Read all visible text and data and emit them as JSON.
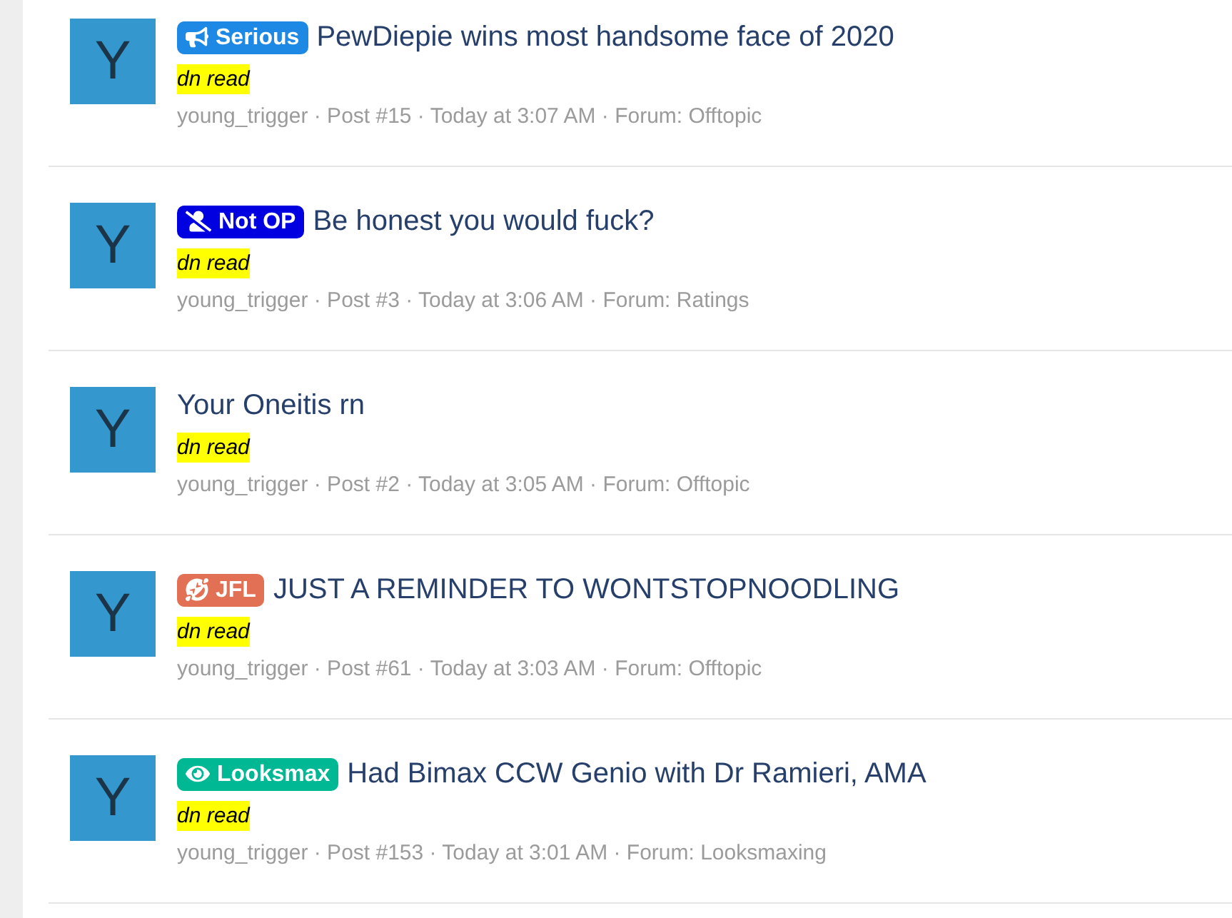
{
  "posts": [
    {
      "avatar": "Y",
      "prefix": {
        "kind": "megaphone",
        "label": "Serious",
        "color": "#1e88e5"
      },
      "title": "PewDiepie wins most handsome face of 2020",
      "note": "dn read",
      "meta": "young_trigger · Post #15 · Today at 3:07 AM · Forum: Offtopic"
    },
    {
      "avatar": "Y",
      "prefix": {
        "kind": "user-slash",
        "label": "Not OP",
        "color": "#0000e0"
      },
      "title": "Be honest you would fuck?",
      "note": "dn read",
      "meta": "young_trigger · Post #3 · Today at 3:06 AM · Forum: Ratings"
    },
    {
      "avatar": "Y",
      "title": "Your Oneitis rn",
      "note": "dn read",
      "meta": "young_trigger · Post #2 · Today at 3:05 AM · Forum: Offtopic"
    },
    {
      "avatar": "Y",
      "prefix": {
        "kind": "laugh",
        "label": "JFL",
        "color": "#e17055"
      },
      "title": "JUST A REMINDER TO WONTSTOPNOODLING",
      "note": "dn read",
      "meta": "young_trigger · Post #61 · Today at 3:03 AM · Forum: Offtopic"
    },
    {
      "avatar": "Y",
      "prefix": {
        "kind": "eye",
        "label": "Looksmax",
        "color": "#00b894"
      },
      "title": "Had Bimax CCW Genio with Dr Ramieri, AMA",
      "note": "dn read",
      "meta": "young_trigger · Post #153 · Today at 3:01 AM · Forum: Looksmaxing"
    }
  ]
}
